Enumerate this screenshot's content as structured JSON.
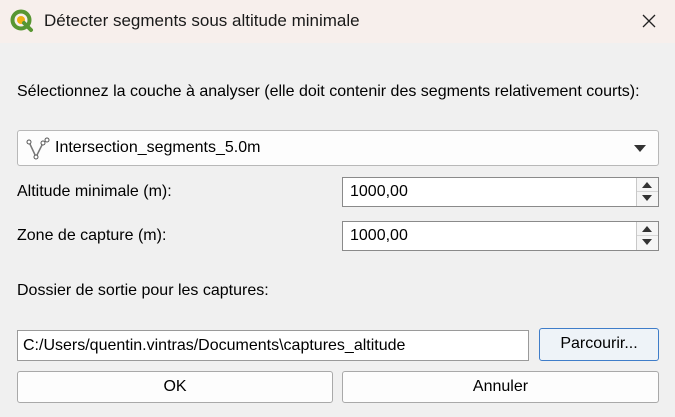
{
  "window": {
    "title": "Détecter segments sous altitude minimale",
    "app_icon": "qgis-icon",
    "close_icon": "close-icon"
  },
  "layer_select": {
    "prompt": "Sélectionnez la couche à analyser (elle doit contenir des segments relativement courts):",
    "selected": "Intersection_segments_5.0m",
    "icon": "line-layer-icon"
  },
  "min_altitude": {
    "label": "Altitude minimale (m):",
    "value": "1000,00"
  },
  "capture_zone": {
    "label": "Zone de capture (m):",
    "value": "1000,00"
  },
  "output": {
    "label": "Dossier de sortie pour les captures:",
    "path": "C:/Users/quentin.vintras/Documents\\captures_altitude",
    "browse_label": "Parcourir..."
  },
  "buttons": {
    "ok_label": "OK",
    "cancel_label": "Annuler"
  }
}
